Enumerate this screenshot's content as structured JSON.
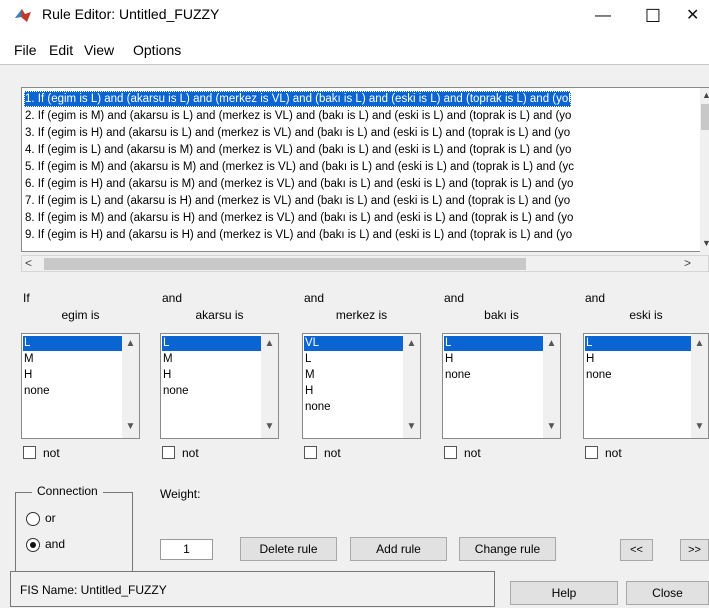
{
  "window": {
    "title": "Rule Editor: Untitled_FUZZY",
    "minimize": "—",
    "maximize": "☐",
    "close": "✕"
  },
  "menu": [
    "File",
    "Edit",
    "View",
    "Options"
  ],
  "rules": [
    "1. If (egim is L) and (akarsu is L) and (merkez is VL) and (bakı is L) and (eski is L) and (toprak is L) and (yol",
    "2. If (egim is M) and (akarsu is L) and (merkez is VL) and (bakı is L) and (eski is L) and (toprak is L) and (yo",
    "3. If (egim is H) and (akarsu is L) and (merkez is VL) and (bakı is L) and (eski is L) and (toprak is L) and (yo",
    "4. If (egim is L) and (akarsu is M) and (merkez is VL) and (bakı is L) and (eski is L) and (toprak is L) and (yo",
    "5. If (egim is M) and (akarsu is M) and (merkez is VL) and (bakı is L) and (eski is L) and (toprak is L) and (yc",
    "6. If (egim is H) and (akarsu is M) and (merkez is VL) and (bakı is L) and (eski is L) and (toprak is L) and (yo",
    "7. If (egim is L) and (akarsu is H) and (merkez is VL) and (bakı is L) and (eski is L) and (toprak is L) and (yo",
    "8. If (egim is M) and (akarsu is H) and (merkez is VL) and (bakı is L) and (eski is L) and (toprak is L) and (yo",
    "9. If (egim is H) and (akarsu is H) and (merkez is VL) and (bakı is L) and (eski is L) and (toprak is L) and (yo"
  ],
  "selected_rule": 0,
  "columns": [
    {
      "connector": "If",
      "var_label": "egim is",
      "options": [
        "L",
        "M",
        "H",
        "none"
      ],
      "selected": 0,
      "not_label": "not"
    },
    {
      "connector": "and",
      "var_label": "akarsu is",
      "options": [
        "L",
        "M",
        "H",
        "none"
      ],
      "selected": 0,
      "not_label": "not"
    },
    {
      "connector": "and",
      "var_label": "merkez is",
      "options": [
        "VL",
        "L",
        "M",
        "H",
        "none"
      ],
      "selected": 0,
      "not_label": "not"
    },
    {
      "connector": "and",
      "var_label": "bakı is",
      "options": [
        "L",
        "H",
        "none"
      ],
      "selected": 0,
      "not_label": "not"
    },
    {
      "connector": "and",
      "var_label": "eski is",
      "options": [
        "L",
        "H",
        "none"
      ],
      "selected": 0,
      "not_label": "not"
    }
  ],
  "connection": {
    "title": "Connection",
    "options": [
      "or",
      "and"
    ],
    "selected": "and"
  },
  "weight": {
    "label": "Weight:",
    "value": "1"
  },
  "buttons": {
    "delete_rule": "Delete rule",
    "add_rule": "Add rule",
    "change_rule": "Change rule",
    "prev": "<<",
    "next": ">>",
    "help": "Help",
    "close": "Close"
  },
  "status": {
    "fis_name": "FIS Name: Untitled_FUZZY"
  },
  "colors": {
    "selection": "#0a64d2",
    "panel": "#f0f0f0"
  }
}
